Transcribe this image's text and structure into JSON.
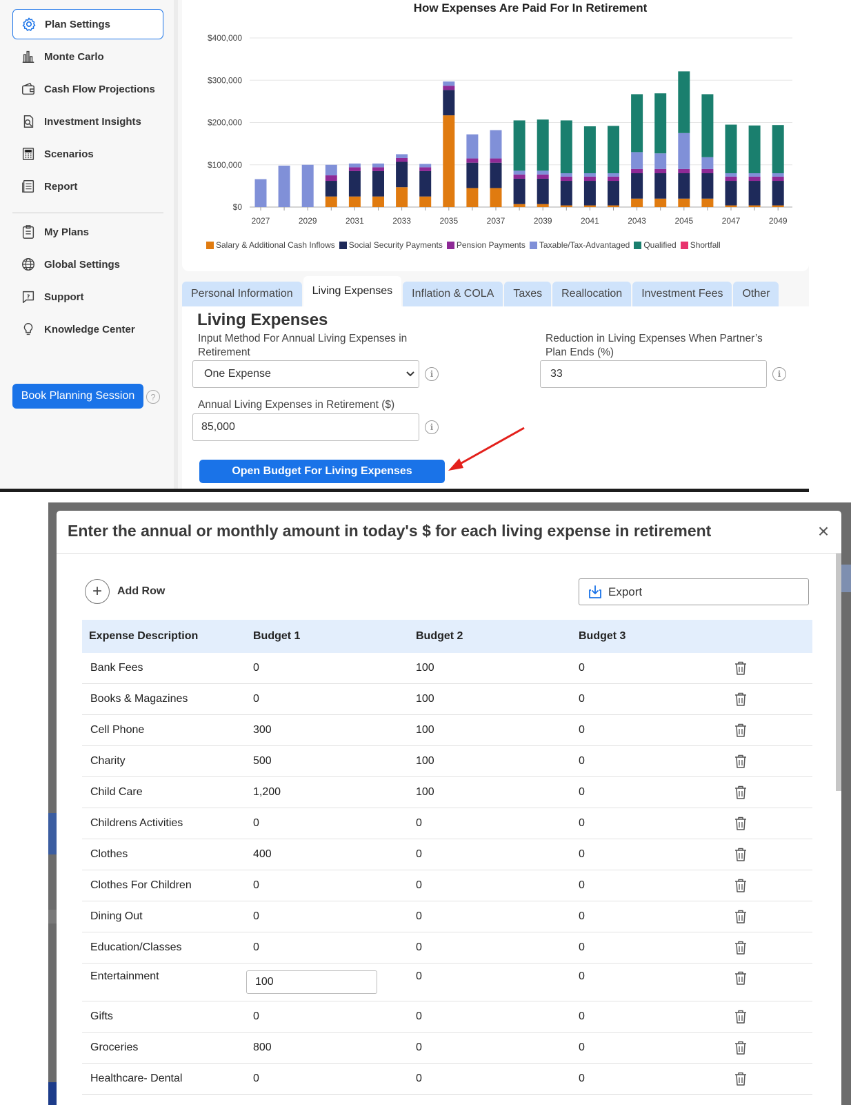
{
  "sidebar": {
    "items": [
      {
        "label": "Plan Settings",
        "icon": "gear-icon"
      },
      {
        "label": "Monte Carlo",
        "icon": "bar-chart-icon"
      },
      {
        "label": "Cash Flow Projections",
        "icon": "wallet-icon"
      },
      {
        "label": "Investment Insights",
        "icon": "search-document-icon"
      },
      {
        "label": "Scenarios",
        "icon": "calculator-icon"
      },
      {
        "label": "Report",
        "icon": "report-icon"
      },
      {
        "label": "My Plans",
        "icon": "clipboard-icon"
      },
      {
        "label": "Global Settings",
        "icon": "globe-icon"
      },
      {
        "label": "Support",
        "icon": "chat-help-icon"
      },
      {
        "label": "Knowledge Center",
        "icon": "lightbulb-icon"
      }
    ],
    "book_label": "Book Planning Session",
    "help_glyph": "?"
  },
  "chart_data": {
    "type": "bar",
    "stacked": true,
    "title": "How Expenses Are Paid For In Retirement",
    "yticks": [
      "$0",
      "$100,000",
      "$200,000",
      "$300,000",
      "$400,000"
    ],
    "ylim": [
      0,
      400000
    ],
    "xticks": [
      "2027",
      "2029",
      "2031",
      "2033",
      "2035",
      "2037",
      "2039",
      "2041",
      "2043",
      "2045",
      "2047",
      "2049"
    ],
    "categories": [
      "2027",
      "2028",
      "2029",
      "2030",
      "2031",
      "2032",
      "2033",
      "2034",
      "2035",
      "2036",
      "2037",
      "2038",
      "2039",
      "2040",
      "2041",
      "2042",
      "2043",
      "2044",
      "2045",
      "2046",
      "2047",
      "2048",
      "2049"
    ],
    "series": [
      {
        "name": "Salary & Additional Cash Inflows",
        "color": "#e07b10",
        "values": [
          0,
          0,
          0,
          25000,
          25000,
          25000,
          47000,
          25000,
          217000,
          45000,
          45000,
          7000,
          7000,
          4000,
          4000,
          4000,
          20000,
          20000,
          20000,
          20000,
          4000,
          4000,
          4000
        ]
      },
      {
        "name": "Social Security Payments",
        "color": "#1e2a5a",
        "values": [
          0,
          0,
          0,
          37000,
          60000,
          60000,
          60000,
          60000,
          60000,
          60000,
          60000,
          60000,
          60000,
          58000,
          58000,
          58000,
          60000,
          60000,
          60000,
          60000,
          58000,
          58000,
          58000
        ]
      },
      {
        "name": "Pension Payments",
        "color": "#8e2a96",
        "values": [
          0,
          0,
          0,
          13000,
          9000,
          9000,
          9000,
          9000,
          10000,
          10000,
          10000,
          10000,
          10000,
          10000,
          10000,
          10000,
          10000,
          10000,
          10000,
          10000,
          10000,
          10000,
          10000
        ]
      },
      {
        "name": "Taxable/Tax-Advantaged",
        "color": "#8090d8",
        "values": [
          66000,
          98000,
          100000,
          25000,
          9000,
          9000,
          9000,
          8000,
          10000,
          57000,
          67000,
          9000,
          9000,
          8000,
          8000,
          8000,
          40000,
          37000,
          85000,
          28000,
          8000,
          8000,
          8000
        ]
      },
      {
        "name": "Qualified",
        "color": "#1a7f6e",
        "values": [
          0,
          0,
          0,
          0,
          0,
          0,
          0,
          0,
          0,
          0,
          0,
          119000,
          121000,
          125000,
          111000,
          112000,
          137000,
          142000,
          146000,
          149000,
          115000,
          113000,
          114000
        ]
      },
      {
        "name": "Shortfall",
        "color": "#e8336d",
        "values": [
          0,
          0,
          0,
          0,
          0,
          0,
          0,
          0,
          0,
          0,
          0,
          0,
          0,
          0,
          0,
          0,
          0,
          0,
          0,
          0,
          0,
          0,
          0
        ]
      }
    ]
  },
  "tabs": [
    {
      "label": "Personal Information",
      "active": false
    },
    {
      "label": "Living Expenses",
      "active": true
    },
    {
      "label": "Inflation & COLA",
      "active": false
    },
    {
      "label": "Taxes",
      "active": false
    },
    {
      "label": "Reallocation",
      "active": false
    },
    {
      "label": "Investment Fees",
      "active": false
    },
    {
      "label": "Other",
      "active": false
    }
  ],
  "living_expenses": {
    "title": "Living Expenses",
    "input_method_label": "Input Method For Annual Living Expenses in Retirement",
    "input_method_value": "One Expense",
    "reduction_label": "Reduction in Living Expenses When Partner’s Plan Ends (%)",
    "reduction_value": "33",
    "annual_label": "Annual Living Expenses in Retirement ($)",
    "annual_value": "85,000",
    "open_budget_label": "Open Budget For Living Expenses",
    "info_glyph": "i"
  },
  "modal": {
    "title": "Enter the annual or monthly amount in today's $ for each living expense in retirement",
    "close_glyph": "×",
    "add_row_label": "Add Row",
    "add_glyph": "+",
    "export_label": "Export",
    "columns": [
      "Expense Description",
      "Budget 1",
      "Budget 2",
      "Budget 3"
    ],
    "rows": [
      [
        "Bank Fees",
        "0",
        "100",
        "0"
      ],
      [
        "Books & Magazines",
        "0",
        "100",
        "0"
      ],
      [
        "Cell Phone",
        "300",
        "100",
        "0"
      ],
      [
        "Charity",
        "500",
        "100",
        "0"
      ],
      [
        "Child Care",
        "1,200",
        "100",
        "0"
      ],
      [
        "Childrens Activities",
        "0",
        "0",
        "0"
      ],
      [
        "Clothes",
        "400",
        "0",
        "0"
      ],
      [
        "Clothes For Children",
        "0",
        "0",
        "0"
      ],
      [
        "Dining Out",
        "0",
        "0",
        "0"
      ],
      [
        "Education/Classes",
        "0",
        "0",
        "0"
      ],
      [
        "Entertainment",
        "100",
        "0",
        "0"
      ],
      [
        "Gifts",
        "0",
        "0",
        "0"
      ],
      [
        "Groceries",
        "800",
        "0",
        "0"
      ],
      [
        "Healthcare- Dental",
        "0",
        "0",
        "0"
      ]
    ],
    "editing_row_index": 10
  }
}
